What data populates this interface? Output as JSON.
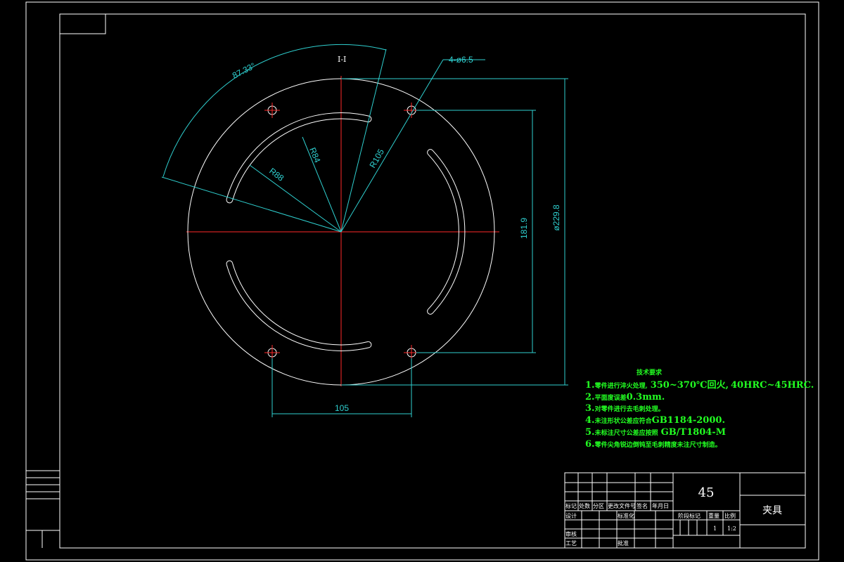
{
  "drawing": {
    "section_mark": "I-I",
    "dimensions": {
      "angle": "87.33°",
      "holes": "4-ø6.5",
      "r_slot_inner": "R84",
      "r_slot_outer": "R88",
      "r_holes": "R105",
      "vertical_span": "181.9",
      "diameter": "ø229.8",
      "horizontal_span": "105"
    }
  },
  "tech_req": {
    "title": "技术要求",
    "items": [
      {
        "num": "1.",
        "cn": "零件进行淬火处理,",
        "en": "350~370℃回火,",
        "en2": "40HRC~45HRC."
      },
      {
        "num": "2.",
        "cn": "平面度误差",
        "en": "0.3mm."
      },
      {
        "num": "3.",
        "cn": "对零件进行去毛刺处理。"
      },
      {
        "num": "4.",
        "cn": "未注形状公差应符合",
        "en": "GB1184-2000."
      },
      {
        "num": "5.",
        "cn": "未标注尺寸公差应按照",
        "en": "GB/T1804-M"
      },
      {
        "num": "6.",
        "cn": "零件尖角锐边倒钝至毛刺精度未注尺寸制造。"
      }
    ]
  },
  "title_block": {
    "material": "45",
    "part_name": "夹具",
    "h_mark": "标记",
    "h_count": "处数",
    "h_zone": "分区",
    "h_doc": "更改文件号",
    "h_sign": "签名",
    "h_date": "年月日",
    "h_design": "设计",
    "h_std": "标准化",
    "h_check": "审核",
    "h_process": "工艺",
    "h_approve": "批准",
    "h_stage": "阶段标记",
    "h_weight": "重量",
    "h_scale": "比例",
    "weight": "1",
    "scale": "1:2"
  }
}
